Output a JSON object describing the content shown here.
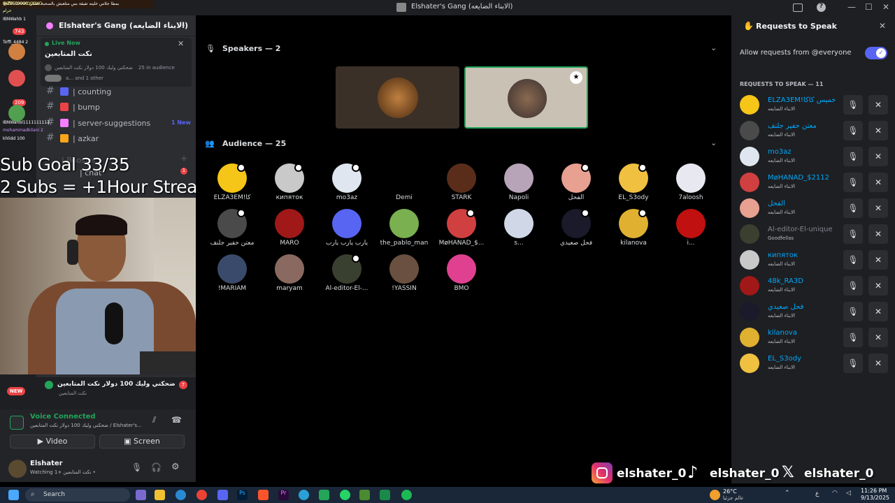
{
  "titlebar": {
    "title": "Elshater's Gang (الابناء الضايعه)",
    "ticker": "@Zeus9990 بمطا جلاس خليته تفيقة بس متلعبش بالصحبة عشان"
  },
  "server": {
    "name": "Elshater's Gang (الابناء الضايعه)"
  },
  "live": {
    "badge": "Live Now",
    "title": "نكت المتابعين",
    "stage_line": "ضحكني وليك 100 دولار نكت المتابعين",
    "audience": "25 in audience",
    "others": "a... and 1 other"
  },
  "channels": [
    {
      "label": "| counting",
      "color": "#5865f2"
    },
    {
      "label": "| bump",
      "color": "#ed4245"
    },
    {
      "label": "| server-suggestions",
      "color": "#f47fff",
      "badge": "1 New"
    },
    {
      "label": "| azkar",
      "color": "#faa61a"
    }
  ],
  "hidden_channel": {
    "label": "| Booster",
    "sub": "| chat",
    "count": "1"
  },
  "overlay_chat": [
    "8efffEDXXXOOOXO",
    "حرام",
    "IBNWahb 1",
    "743",
    "Toffi_4484 2",
    "209",
    "IBNWahbl1111111111",
    "mohammadkilani 2",
    "khlidd 100"
  ],
  "sub_goal": {
    "line1": "Sub Goal 33/35",
    "line2": "2 Subs = +1Hour Stream"
  },
  "stage_notice": {
    "title": "ضحكني وليك 100 دولار نكت المتابعين",
    "sub": "نكت المتابعين",
    "count": "7",
    "new": "NEW"
  },
  "voice": {
    "status": "Voice Connected",
    "channel": "ضحكني وليك 100 دولار نكت المتابعين / Elshater's...",
    "video_label": "Video",
    "screen_label": "Screen"
  },
  "user": {
    "name": "Elshater",
    "status": "Watching نكت المتابعين +1 •"
  },
  "speakers": {
    "header": "Speakers — 2"
  },
  "audience": {
    "header": "Audience — 25",
    "members": [
      {
        "name": "ELZA3EM!كا",
        "color": "#f5c518",
        "badge": true
      },
      {
        "name": "кипяток",
        "color": "#c9c9c9",
        "badge": true
      },
      {
        "name": "mo3az",
        "color": "#dfe6f0",
        "badge": true
      },
      {
        "name": "Demi",
        "color": "#000000",
        "badge": false
      },
      {
        "name": "STARK",
        "color": "#5a2d1a",
        "badge": false
      },
      {
        "name": "Napoli",
        "color": "#b8a4b8",
        "badge": false
      },
      {
        "name": "الفحل",
        "color": "#e8a090",
        "badge": true
      },
      {
        "name": "EL_S3ody",
        "color": "#f0c040",
        "badge": true
      },
      {
        "name": "7aloosh",
        "color": "#e8e8f0",
        "badge": false
      },
      {
        "name": "معتن حفير جلنف",
        "color": "#4a4a4a",
        "badge": true
      },
      {
        "name": "MARO",
        "color": "#a01818",
        "badge": false
      },
      {
        "name": "يارب يارب يارب",
        "color": "#5865f2",
        "badge": false
      },
      {
        "name": "the_pablo_man",
        "color": "#7ab050",
        "badge": false
      },
      {
        "name": "MøHANAD_$...",
        "color": "#d04040",
        "badge": true
      },
      {
        "name": "s...",
        "color": "#d0d8e8",
        "badge": false
      },
      {
        "name": "فحل صعيدي",
        "color": "#1a1a2a",
        "badge": true
      },
      {
        "name": "kilanova",
        "color": "#e0b030",
        "badge": true
      },
      {
        "name": "i...",
        "color": "#c01010",
        "badge": false
      },
      {
        "name": "!MARIAM",
        "color": "#3a4a6a",
        "badge": false
      },
      {
        "name": "maryam",
        "color": "#8a6a60",
        "badge": false
      },
      {
        "name": "Al-editor-El-...",
        "color": "#3a4030",
        "badge": true
      },
      {
        "name": "!YASSIN",
        "color": "#6a5040",
        "badge": false
      },
      {
        "name": "BMO",
        "color": "#e04090",
        "badge": false
      }
    ]
  },
  "requests_panel": {
    "title": "Requests to Speak",
    "allow_label": "Allow requests from @everyone",
    "list_header": "REQUESTS TO SPEAK — 11",
    "role": "الابناء الضايعه",
    "items": [
      {
        "name": "ELZA3EM!خميس كاكا",
        "color": "#f5c518",
        "dim": false
      },
      {
        "name": "معتن حفير جلنف",
        "color": "#4a4a4a",
        "dim": false
      },
      {
        "name": "mo3az",
        "color": "#dfe6f0",
        "dim": false
      },
      {
        "name": "MøHANAD_$2112",
        "color": "#d04040",
        "dim": false
      },
      {
        "name": "الفحل",
        "color": "#e8a090",
        "dim": false
      },
      {
        "name": "Al-editor-El-unique",
        "color": "#3a4030",
        "dim": true,
        "sub": "Goodfellas"
      },
      {
        "name": "кипяток",
        "color": "#c9c9c9",
        "dim": false
      },
      {
        "name": "48k_RA3D",
        "color": "#a01818",
        "dim": false
      },
      {
        "name": "فحل صعيدي",
        "color": "#1a1a2a",
        "dim": false
      },
      {
        "name": "kilanova",
        "color": "#e0b030",
        "dim": false
      },
      {
        "name": "EL_S3ody",
        "color": "#f0c040",
        "dim": false
      }
    ]
  },
  "social": {
    "instagram": "elshater_0",
    "tiktok": "elshater_0",
    "x": "elshater_0"
  },
  "taskbar": {
    "search": "Search",
    "weather": "26°C",
    "weather_sub": "عالم جزئيا",
    "time": "11:26 PM",
    "date": "9/13/2025",
    "lang": "ع"
  }
}
